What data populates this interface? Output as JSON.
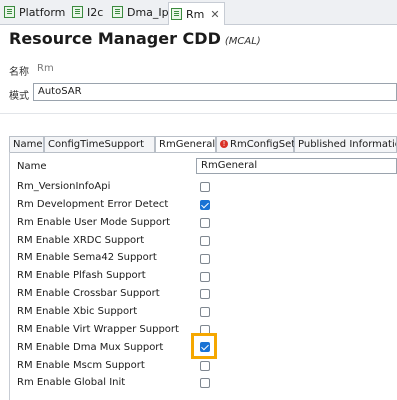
{
  "tabs": [
    {
      "label": "Platform",
      "active": false
    },
    {
      "label": "I2c",
      "active": false
    },
    {
      "label": "Dma_Ip",
      "active": false
    },
    {
      "label": "Rm",
      "active": true
    }
  ],
  "header": {
    "title": "Resource Manager CDD",
    "subtitle": "(MCAL)"
  },
  "name_field": {
    "label": "名称",
    "value": "Rm"
  },
  "variant_field": {
    "label": "模式",
    "value": "AutoSAR"
  },
  "param_tabs": [
    "Name",
    "ConfigTimeSupport",
    "RmGeneral",
    "RmConfigSet",
    "Published Information"
  ],
  "error_icon": "!",
  "table": {
    "name_label": "Name",
    "name_value": "RmGeneral",
    "params": [
      {
        "label": "Rm_VersionInfoApi",
        "checked": false
      },
      {
        "label": "Rm Development Error Detect",
        "checked": true
      },
      {
        "label": "Rm Enable User Mode Support",
        "checked": false
      },
      {
        "label": "RM Enable XRDC Support",
        "checked": false
      },
      {
        "label": "RM Enable Sema42 Support",
        "checked": false
      },
      {
        "label": "RM Enable Plfash Support",
        "checked": false
      },
      {
        "label": "RM Enable Crossbar Support",
        "checked": false
      },
      {
        "label": "RM Enable Xbic Support",
        "checked": false
      },
      {
        "label": "RM Enable Virt Wrapper Support",
        "checked": false
      },
      {
        "label": "RM Enable Dma Mux Support",
        "checked": true
      },
      {
        "label": "RM Enable Mscm Support",
        "checked": false
      },
      {
        "label": "Rm Enable Global Init",
        "checked": false
      }
    ]
  },
  "colors": {
    "accent": "#1a73d4",
    "highlight": "#f5a700",
    "error": "#d93025"
  }
}
